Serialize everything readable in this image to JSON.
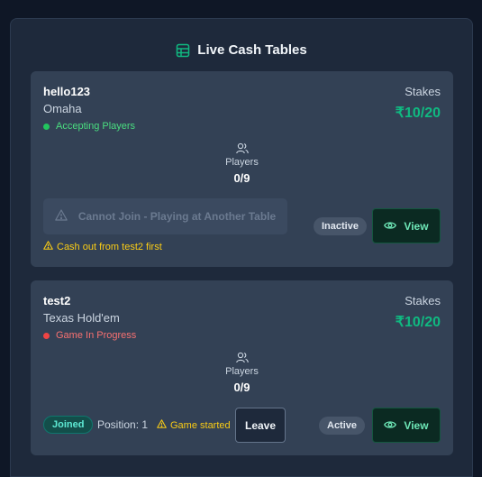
{
  "panel": {
    "title": "Live Cash Tables"
  },
  "tables": [
    {
      "name": "hello123",
      "game": "Omaha",
      "status": "Accepting Players",
      "status_color": "#22c55e",
      "stakes_label": "Stakes",
      "stakes": "₹10/20",
      "players_label": "Players",
      "players_count": "0/9",
      "join_button": "Cannot Join - Playing at Another Table",
      "warning": "Cash out from test2 first",
      "state_badge": "Inactive",
      "view_button": "View"
    },
    {
      "name": "test2",
      "game": "Texas Hold'em",
      "status": "Game In Progress",
      "status_color": "#ef4444",
      "stakes_label": "Stakes",
      "stakes": "₹10/20",
      "players_label": "Players",
      "players_count": "0/9",
      "joined_badge": "Joined",
      "position": "Position: 1",
      "started_note": "Game started",
      "leave_button": "Leave",
      "state_badge": "Active",
      "view_button": "View"
    }
  ],
  "colors": {
    "accent": "#10b981",
    "warning": "#facc15"
  }
}
